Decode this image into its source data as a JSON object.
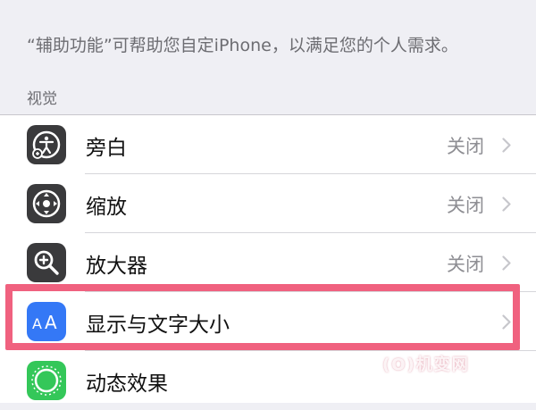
{
  "description": "“辅助功能”可帮助您自定iPhone，以满足您的个人需求。",
  "section_header": "视觉",
  "rows": [
    {
      "label": "旁白",
      "value": "关闭",
      "icon": "voiceover-icon",
      "icon_color": "#3a3a3c"
    },
    {
      "label": "缩放",
      "value": "关闭",
      "icon": "zoom-icon",
      "icon_color": "#3a3a3c"
    },
    {
      "label": "放大器",
      "value": "关闭",
      "icon": "magnifier-icon",
      "icon_color": "#3a3a3c"
    },
    {
      "label": "显示与文字大小",
      "value": "",
      "icon": "text-size-icon",
      "icon_color": "#3478f6"
    },
    {
      "label": "动态效果",
      "value": "",
      "icon": "motion-icon",
      "icon_color": "#34c759"
    }
  ],
  "highlight_color": "#f0617f",
  "watermark": "(O)机变网"
}
